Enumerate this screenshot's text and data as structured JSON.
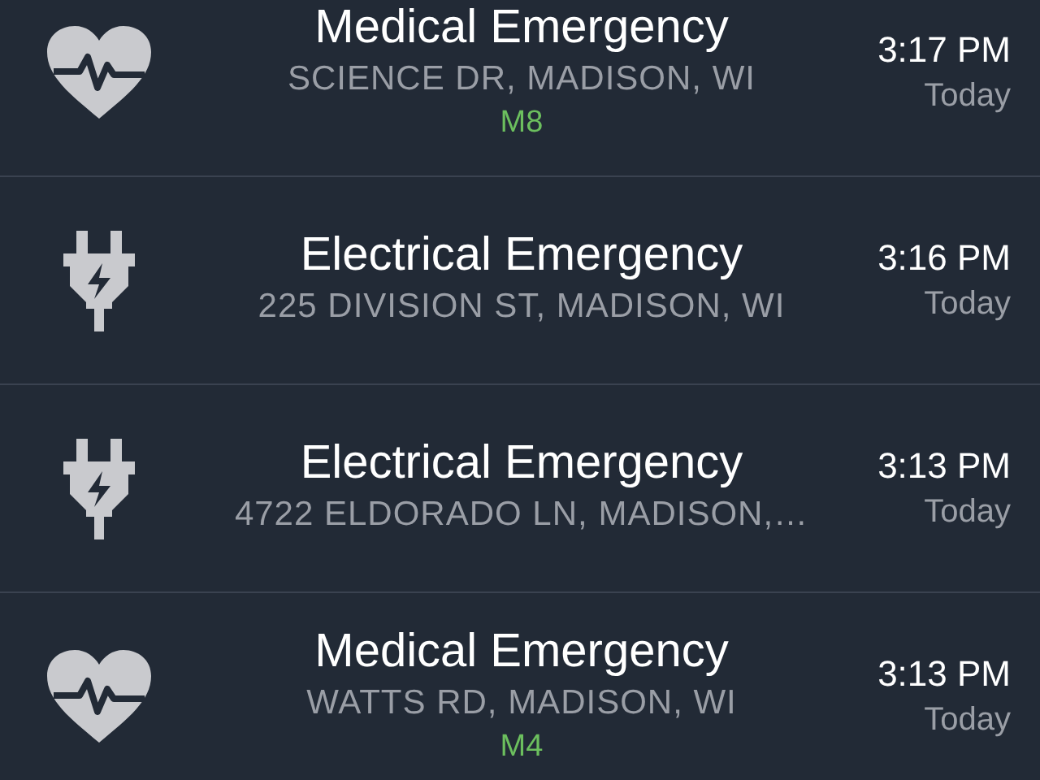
{
  "incidents": [
    {
      "kind": "medical",
      "title": "Medical Emergency",
      "address": "SCIENCE DR, MADISON, WI",
      "unit": "M8",
      "time": "3:17 PM",
      "day": "Today"
    },
    {
      "kind": "electrical",
      "title": "Electrical Emergency",
      "address": "225 DIVISION ST, MADISON, WI",
      "time": "3:16 PM",
      "day": "Today"
    },
    {
      "kind": "electrical",
      "title": "Electrical Emergency",
      "address": "4722 ELDORADO LN, MADISON,…",
      "time": "3:13 PM",
      "day": "Today"
    },
    {
      "kind": "medical",
      "title": "Medical Emergency",
      "address": "WATTS RD, MADISON, WI",
      "unit": "M4",
      "time": "3:13 PM",
      "day": "Today"
    }
  ]
}
